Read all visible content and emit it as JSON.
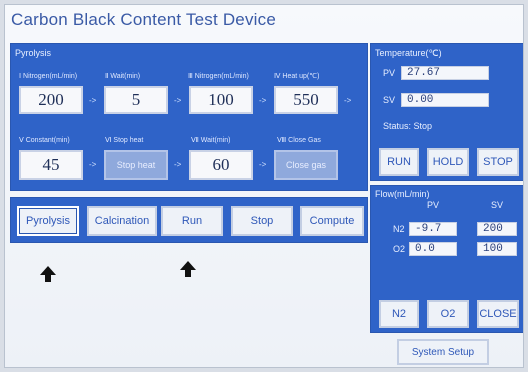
{
  "window": {
    "title": "Carbon Black Content Test Device"
  },
  "pyrolysis": {
    "label": "Pyrolysis",
    "steps": [
      {
        "label": "Ⅰ Nitrogen(mL/min)",
        "value": "200"
      },
      {
        "label": "Ⅱ Wait(min)",
        "value": "5"
      },
      {
        "label": "Ⅲ Nitrogen(mL/min)",
        "value": "100"
      },
      {
        "label": "Ⅳ Heat up(℃)",
        "value": "550"
      },
      {
        "label": "Ⅴ Constant(min)",
        "value": "45"
      },
      {
        "label": "Ⅵ Stop heat",
        "value": "Stop heat"
      },
      {
        "label": "Ⅶ Wait(min)",
        "value": "60"
      },
      {
        "label": "Ⅷ Close Gas",
        "value": "Close gas"
      }
    ],
    "arrow": "->"
  },
  "mode_buttons": {
    "pyrolysis": "Pyrolysis",
    "calcination": "Calcination",
    "run": "Run",
    "stop": "Stop",
    "compute": "Compute"
  },
  "temperature": {
    "label": "Temperature(℃)",
    "pv_label": "PV",
    "pv": "27.67",
    "sv_label": "SV",
    "sv": "0.00",
    "status": "Status:  Stop",
    "buttons": {
      "run": "RUN",
      "hold": "HOLD",
      "stop": "STOP"
    }
  },
  "flow": {
    "label": "Flow(mL/min)",
    "pv_header": "PV",
    "sv_header": "SV",
    "rows": [
      {
        "gas": "N2",
        "pv": "-9.7",
        "sv": "200"
      },
      {
        "gas": "O2",
        "pv": "0.0",
        "sv": "100"
      }
    ],
    "buttons": {
      "n2": "N2",
      "o2": "O2",
      "close": "CLOSE"
    }
  },
  "system_setup": "System Setup",
  "colors": {
    "panel": "#2f63c8",
    "accent": "#2f58b8",
    "background": "#f2f5fa"
  },
  "icons": [
    "up-arrow-icon",
    "up-arrow-icon"
  ]
}
